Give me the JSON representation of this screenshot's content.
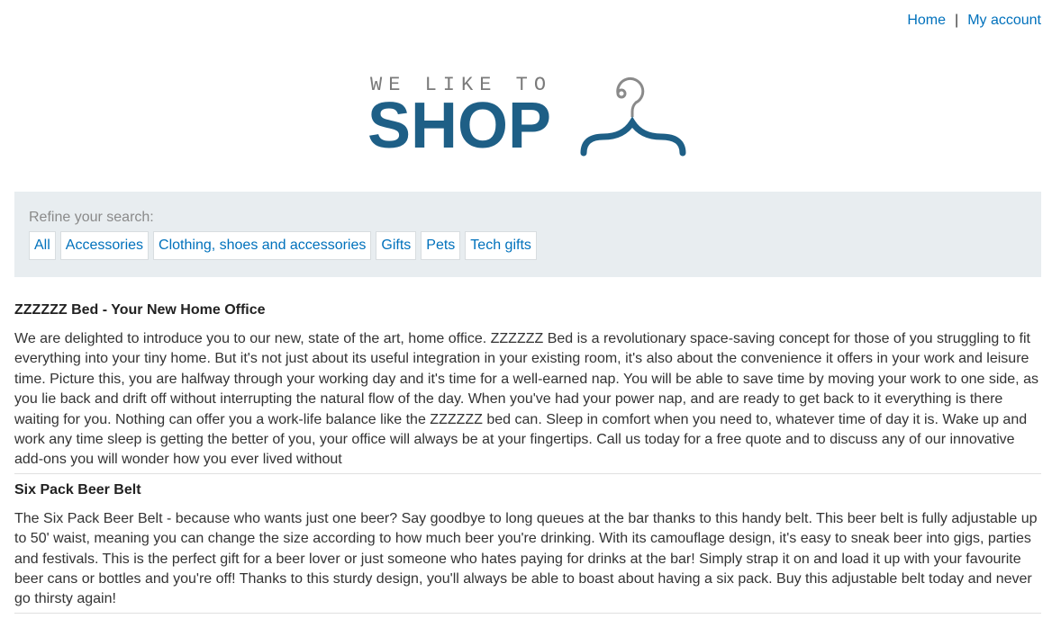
{
  "nav": {
    "home": "Home",
    "separator": "|",
    "account": "My account"
  },
  "logo": {
    "tagline": "WE LIKE TO",
    "wordmark": "SHOP",
    "icon": "hanger-icon",
    "colors": {
      "wordmark": "#1e5f86",
      "tagline": "#7a7a7a"
    }
  },
  "filters": {
    "label": "Refine your search:",
    "items": [
      "All",
      "Accessories",
      "Clothing, shoes and accessories",
      "Gifts",
      "Pets",
      "Tech gifts"
    ]
  },
  "products": [
    {
      "title": "ZZZZZZ Bed - Your New Home Office",
      "description": "We are delighted to introduce you to our new, state of the art, home office. ZZZZZZ Bed is a revolutionary space-saving concept for those of you struggling to fit everything into your tiny home. But it's not just about its useful integration in your existing room, it's also about the convenience it offers in your work and leisure time. Picture this, you are halfway through your working day and it's time for a well-earned nap. You will be able to save time by moving your work to one side, as you lie back and drift off without interrupting the natural flow of the day. When you've had your power nap, and are ready to get back to it everything is there waiting for you. Nothing can offer you a work-life balance like the ZZZZZZ bed can. Sleep in comfort when you need to, whatever time of day it is. Wake up and work any time sleep is getting the better of you, your office will always be at your fingertips. Call us today for a free quote and to discuss any of our innovative add-ons you will wonder how you ever lived without"
    },
    {
      "title": "Six Pack Beer Belt",
      "description": "The Six Pack Beer Belt - because who wants just one beer? Say goodbye to long queues at the bar thanks to this handy belt. This beer belt is fully adjustable up to 50' waist, meaning you can change the size according to how much beer you're drinking. With its camouflage design, it's easy to sneak beer into gigs, parties and festivals. This is the perfect gift for a beer lover or just someone who hates paying for drinks at the bar! Simply strap it on and load it up with your favourite beer cans or bottles and you're off! Thanks to this sturdy design, you'll always be able to boast about having a six pack. Buy this adjustable belt today and never go thirsty again!"
    }
  ],
  "colors": {
    "link": "#0071bc",
    "filter_bg": "#e8edf0"
  }
}
